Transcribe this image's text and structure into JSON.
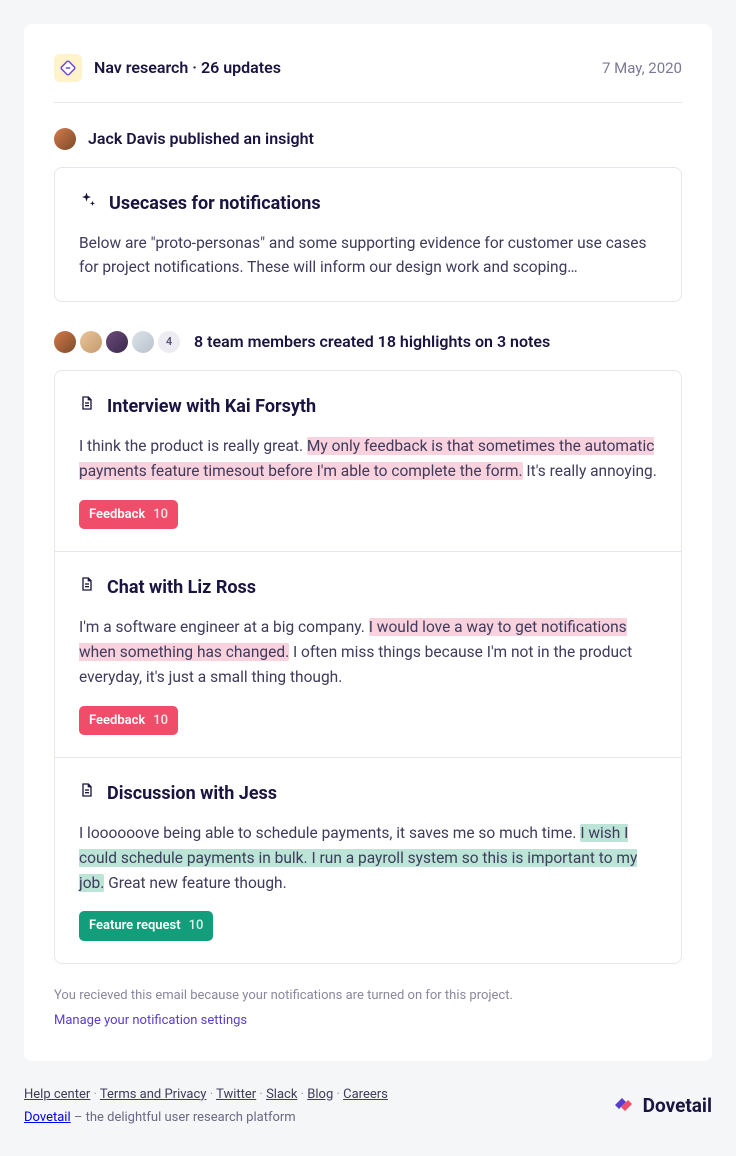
{
  "header": {
    "project": "Nav research",
    "separator": " · ",
    "updates": "26 updates",
    "date": "7 May, 2020"
  },
  "insight": {
    "byline": "Jack Davis published an insight",
    "title": "Usecases for notifications",
    "body": "Below are \"proto-personas\" and some supporting evidence for customer use cases for project notifications. These will inform our design work and scoping…"
  },
  "highlights": {
    "more_count": "4",
    "summary": "8 team members created 18 highlights on 3 notes"
  },
  "notes": [
    {
      "title": "Interview with Kai Forsyth",
      "pre": "I think the product is really great. ",
      "hl": "My only feedback is that sometimes the automatic payments feature timesout before I'm able to complete the form.",
      "post": " It's really annoying.",
      "hl_class": "hl-pink",
      "tag_label": "Feedback",
      "tag_count": "10",
      "tag_class": "tag-pink"
    },
    {
      "title": "Chat with Liz Ross",
      "pre": "I'm a software engineer at a big company. ",
      "hl": "I would love a way to get notifications when something has changed.",
      "post": " I often miss things because I'm not in the product everyday, it's just a small thing though.",
      "hl_class": "hl-pink",
      "tag_label": "Feedback",
      "tag_count": "10",
      "tag_class": "tag-pink"
    },
    {
      "title": "Discussion with Jess",
      "pre": "I loooooove being able to schedule payments, it saves me so much time. ",
      "hl": "I wish I could schedule payments in bulk. I run a payroll system so this is important to my job.",
      "post": " Great new feature though.",
      "hl_class": "hl-teal",
      "tag_label": "Feature request",
      "tag_count": "10",
      "tag_class": "tag-teal"
    }
  ],
  "card_footer": {
    "info": "You recieved this email because your notifications are turned on for this project.",
    "link": "Manage your notification settings"
  },
  "page_footer": {
    "links": [
      "Help center",
      "Terms and Privacy",
      "Twitter",
      "Slack",
      "Blog",
      "Careers"
    ],
    "brand_link": "Dovetail",
    "tagline": " – the delightful user research platform",
    "logo_text": "Dovetail"
  }
}
